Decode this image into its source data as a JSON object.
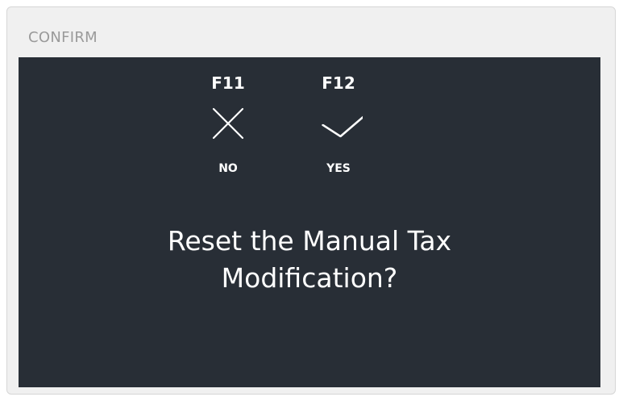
{
  "dialog": {
    "title": "CONFIRM",
    "message_line1": "Reset the Manual Tax",
    "message_line2": "Modification?"
  },
  "actions": [
    {
      "key": "F11",
      "label": "NO",
      "icon": "close-icon"
    },
    {
      "key": "F12",
      "label": "YES",
      "icon": "checkmark-icon"
    }
  ],
  "colors": {
    "body_background": "#282e36",
    "frame_background": "#f0f0f0",
    "title_text": "#9a9a9a",
    "foreground": "#ffffff"
  }
}
